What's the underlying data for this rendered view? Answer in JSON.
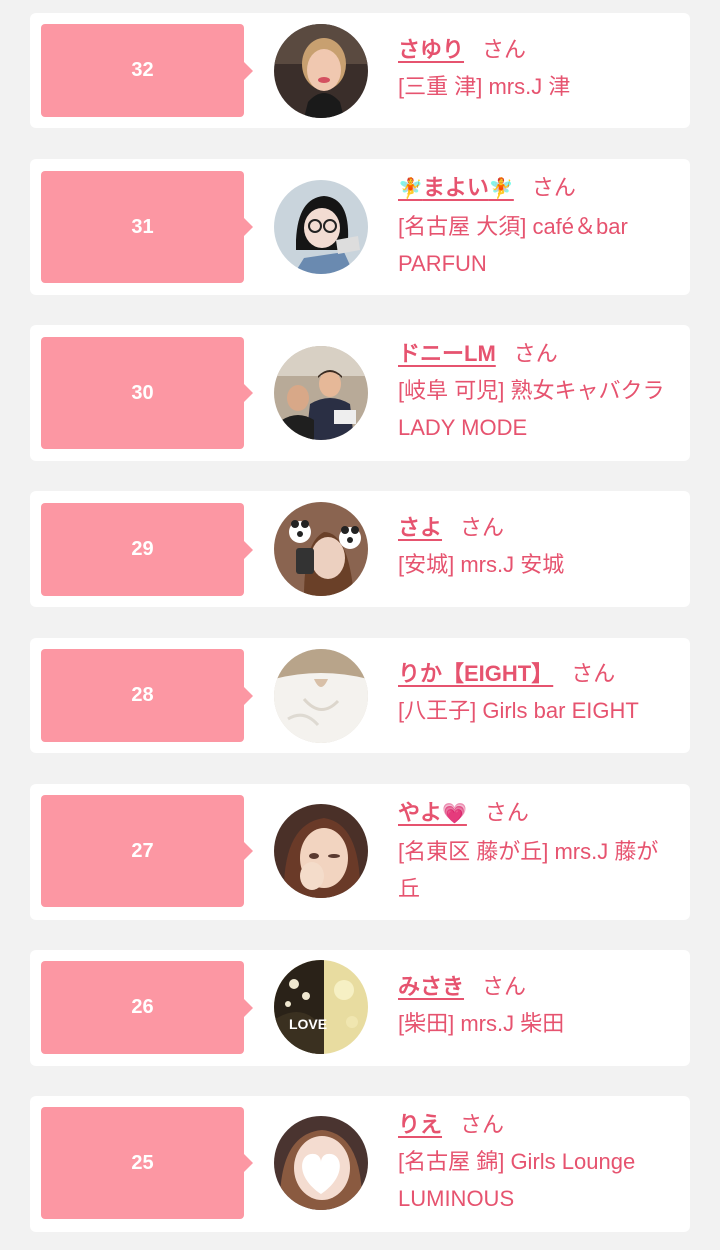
{
  "colors": {
    "background": "#f2f2f2",
    "card": "#ffffff",
    "rank_badge": "#fc97a3",
    "text_accent": "#e6536f"
  },
  "honorific": "さん",
  "entries": [
    {
      "rank": "32",
      "name": "さゆり",
      "shop": "[三重 津] mrs.J 津",
      "avatar_icon": "woman-photo-icon"
    },
    {
      "rank": "31",
      "name_prefix": "🧚",
      "name": "まよい",
      "name_suffix": "🧚",
      "shop": "[名古屋 大須] café＆bar PARFUN",
      "avatar_icon": "glasses-girl-photo-icon"
    },
    {
      "rank": "30",
      "name": "ドニーLM",
      "shop": "[岐阜 可児] 熟女キャバクラ LADY MODE",
      "avatar_icon": "men-photo-icon"
    },
    {
      "rank": "29",
      "name": "さよ",
      "shop": "[安城] mrs.J 安城",
      "avatar_icon": "panda-filter-photo-icon"
    },
    {
      "rank": "28",
      "name": "りか【EIGHT】",
      "shop": "[八王子] Girls bar EIGHT",
      "avatar_icon": "white-shirt-photo-icon"
    },
    {
      "rank": "27",
      "name": "やよ",
      "name_suffix": "💗",
      "shop": "[名東区 藤が丘] mrs.J 藤が丘",
      "avatar_icon": "blurred-woman-photo-icon"
    },
    {
      "rank": "26",
      "name": "みさき",
      "shop": "[柴田] mrs.J 柴田",
      "avatar_icon": "love-graphic-photo-icon",
      "avatar_text": "LOVE"
    },
    {
      "rank": "25",
      "name": "りえ",
      "shop": "[名古屋 錦] Girls Lounge LUMINOUS",
      "avatar_icon": "heart-covered-face-photo-icon"
    }
  ]
}
